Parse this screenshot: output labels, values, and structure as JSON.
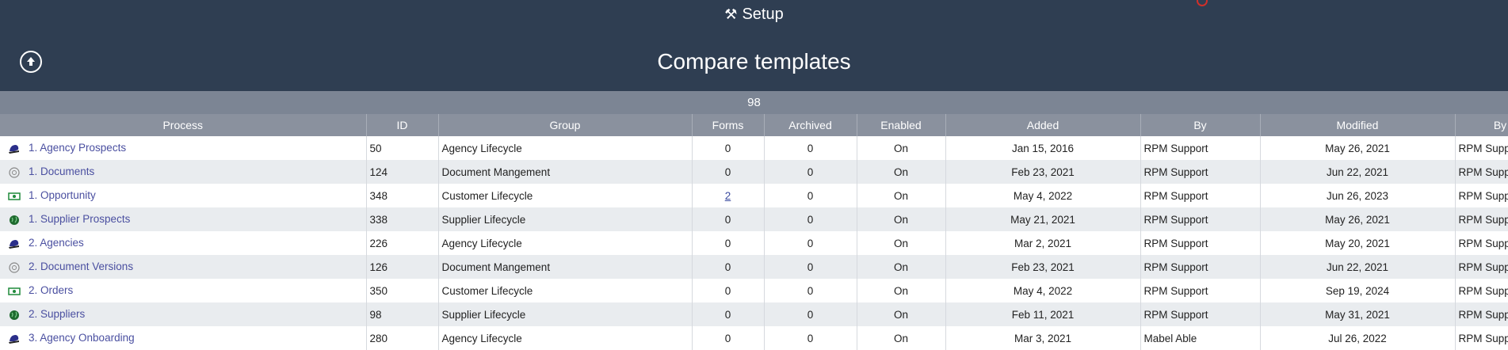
{
  "header": {
    "setup_label": "Setup",
    "title": "Compare templates",
    "count": "98"
  },
  "columns": [
    "Process",
    "ID",
    "Group",
    "Forms",
    "Archived",
    "Enabled",
    "Added",
    "By",
    "Modified",
    "By"
  ],
  "rows": [
    {
      "process": "1. Agency Prospects",
      "icon": "agency-icon",
      "id": "50",
      "group": "Agency Lifecycle",
      "forms": "0",
      "archived": "0",
      "enabled": "On",
      "added": "Jan 15, 2016",
      "by": "RPM Support",
      "modified": "May 26, 2021",
      "by2": "RPM Supp"
    },
    {
      "process": "1. Documents",
      "icon": "document-icon",
      "id": "124",
      "group": "Document Mangement",
      "forms": "0",
      "archived": "0",
      "enabled": "On",
      "added": "Feb 23, 2021",
      "by": "RPM Support",
      "modified": "Jun 22, 2021",
      "by2": "RPM Supp"
    },
    {
      "process": "1. Opportunity",
      "icon": "money-icon",
      "id": "348",
      "group": "Customer Lifecycle",
      "forms": "2",
      "archived": "0",
      "enabled": "On",
      "added": "May 4, 2022",
      "by": "RPM Support",
      "modified": "Jun 26, 2023",
      "by2": "RPM Supp"
    },
    {
      "process": "1. Supplier Prospects",
      "icon": "globe-icon",
      "id": "338",
      "group": "Supplier Lifecycle",
      "forms": "0",
      "archived": "0",
      "enabled": "On",
      "added": "May 21, 2021",
      "by": "RPM Support",
      "modified": "May 26, 2021",
      "by2": "RPM Supp"
    },
    {
      "process": "2. Agencies",
      "icon": "agency-icon",
      "id": "226",
      "group": "Agency Lifecycle",
      "forms": "0",
      "archived": "0",
      "enabled": "On",
      "added": "Mar 2, 2021",
      "by": "RPM Support",
      "modified": "May 20, 2021",
      "by2": "RPM Supp"
    },
    {
      "process": "2. Document Versions",
      "icon": "document-icon",
      "id": "126",
      "group": "Document Mangement",
      "forms": "0",
      "archived": "0",
      "enabled": "On",
      "added": "Feb 23, 2021",
      "by": "RPM Support",
      "modified": "Jun 22, 2021",
      "by2": "RPM Supp"
    },
    {
      "process": "2. Orders",
      "icon": "money-icon",
      "id": "350",
      "group": "Customer Lifecycle",
      "forms": "0",
      "archived": "0",
      "enabled": "On",
      "added": "May 4, 2022",
      "by": "RPM Support",
      "modified": "Sep 19, 2024",
      "by2": "RPM Supp"
    },
    {
      "process": "2. Suppliers",
      "icon": "globe-icon",
      "id": "98",
      "group": "Supplier Lifecycle",
      "forms": "0",
      "archived": "0",
      "enabled": "On",
      "added": "Feb 11, 2021",
      "by": "RPM Support",
      "modified": "May 31, 2021",
      "by2": "RPM Supp"
    },
    {
      "process": "3. Agency Onboarding",
      "icon": "agency-icon",
      "id": "280",
      "group": "Agency Lifecycle",
      "forms": "0",
      "archived": "0",
      "enabled": "On",
      "added": "Mar 3, 2021",
      "by": "Mabel Able",
      "modified": "Jul 26, 2022",
      "by2": "RPM Supp"
    }
  ]
}
